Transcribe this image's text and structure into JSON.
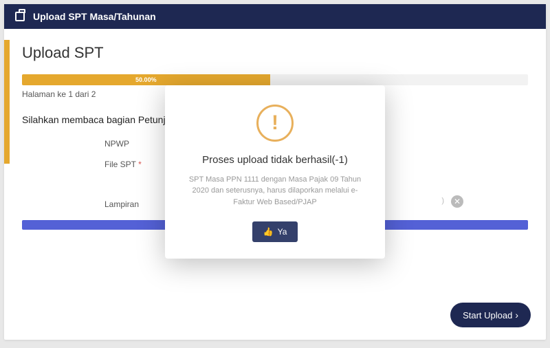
{
  "header": {
    "title": "Upload SPT Masa/Tahunan"
  },
  "page": {
    "title": "Upload SPT",
    "progress_label": "50.00%",
    "progress_width": "49%",
    "counter": "Halaman ke 1 dari 2",
    "instruction": "Silahkan membaca bagian Petunjuk"
  },
  "form": {
    "npwp_label": "NPWP",
    "file_label": "File SPT",
    "file_required": "*",
    "lampiran_label": "Lampiran"
  },
  "clear_paren": ")",
  "footer": {
    "start_label": "Start Upload"
  },
  "modal": {
    "icon_glyph": "!",
    "title": "Proses upload tidak berhasil(-1)",
    "body": "SPT Masa PPN 1111 dengan Masa Pajak 09 Tahun 2020 dan seterusnya, harus dilaporkan melalui e-Faktur Web Based/PJAP",
    "ok_label": "Ya"
  }
}
